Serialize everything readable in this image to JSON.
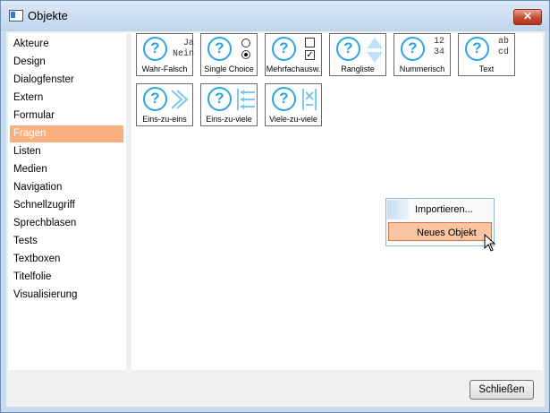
{
  "window": {
    "title": "Objekte",
    "close_glyph": "✕"
  },
  "sidebar": {
    "items": [
      {
        "label": "Akteure"
      },
      {
        "label": "Design"
      },
      {
        "label": "Dialogfenster"
      },
      {
        "label": "Extern"
      },
      {
        "label": "Formular"
      },
      {
        "label": "Fragen",
        "selected": true
      },
      {
        "label": "Listen"
      },
      {
        "label": "Medien"
      },
      {
        "label": "Navigation"
      },
      {
        "label": "Schnellzugriff"
      },
      {
        "label": "Sprechblasen"
      },
      {
        "label": "Tests"
      },
      {
        "label": "Textboxen"
      },
      {
        "label": "Titelfolie"
      },
      {
        "label": "Visualisierung"
      }
    ]
  },
  "tiles": [
    {
      "label": "Wahr-Falsch",
      "icon": "true-false-icon",
      "glyph": "Ja\nNein"
    },
    {
      "label": "Single Choice",
      "icon": "single-choice-icon"
    },
    {
      "label": "Mehrfachausw.",
      "icon": "multiple-choice-icon"
    },
    {
      "label": "Rangliste",
      "icon": "ranking-icon"
    },
    {
      "label": "Nummerisch",
      "icon": "numeric-icon",
      "glyph": "12\n34"
    },
    {
      "label": "Text",
      "icon": "text-icon",
      "glyph": "ab\ncd"
    },
    {
      "label": "Eins-zu-eins",
      "icon": "one-to-one-icon"
    },
    {
      "label": "Eins-zu-viele",
      "icon": "one-to-many-icon"
    },
    {
      "label": "Viele-zu-viele",
      "icon": "many-to-many-icon"
    }
  ],
  "context_menu": {
    "items": [
      {
        "label": "Importieren..."
      },
      {
        "label": "Neues Objekt",
        "highlighted": true
      }
    ]
  },
  "footer": {
    "close_label": "Schließen"
  },
  "colors": {
    "selection": "#f8b07f",
    "icon_blue": "#2aa6df",
    "menu_highlight": "#f9c4a4"
  }
}
